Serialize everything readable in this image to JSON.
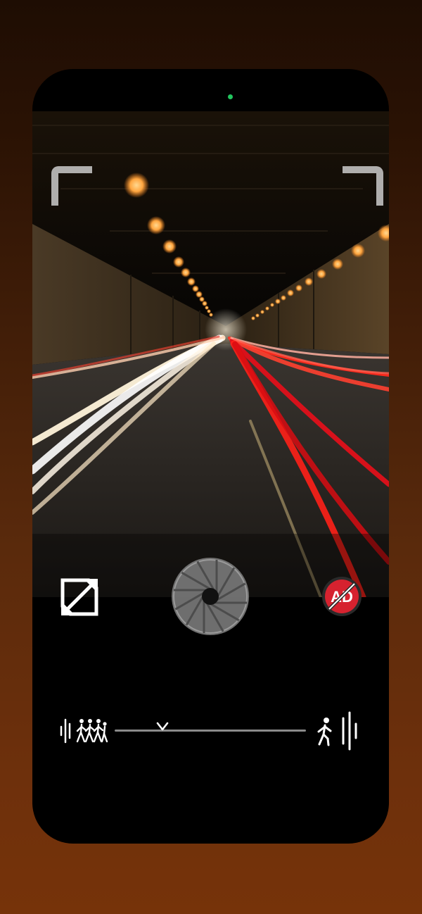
{
  "icons": {
    "status_indicator": "green-dot",
    "expand": "expand-arrows-icon",
    "shutter": "aperture-shutter-icon",
    "no_ads": "no-ads-icon",
    "crowd": "crowd-icon",
    "walker": "single-walker-icon",
    "bars_left": "sound-bars-icon",
    "bars_right": "sound-bars-icon"
  },
  "no_ads_badge": {
    "text": "AD",
    "color": "#d6222f"
  },
  "sensitivity_slider": {
    "value": 0.25
  },
  "colors": {
    "status_dot": "#22c55e",
    "background_top": "#1e0d03",
    "background_bottom": "#763309",
    "accent_red_trails": "#e0101a"
  }
}
